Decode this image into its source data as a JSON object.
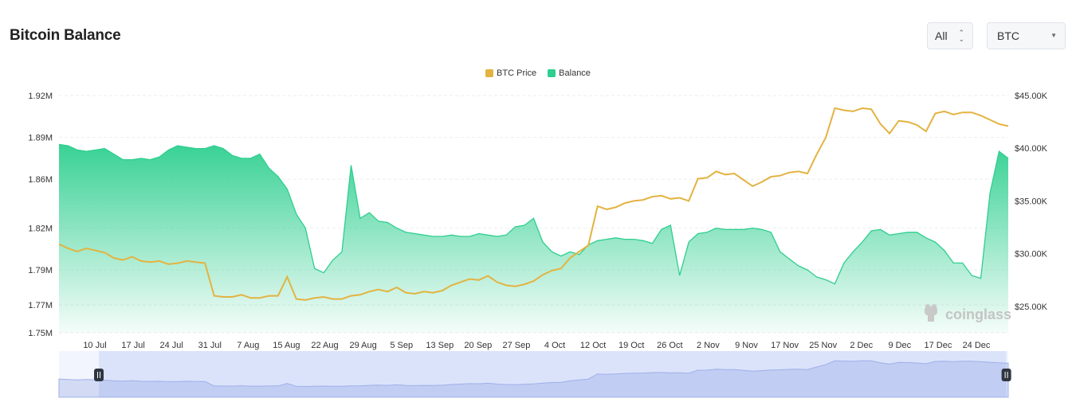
{
  "header": {
    "title": "Bitcoin Balance",
    "range_select": {
      "value": "All"
    },
    "asset_select": {
      "value": "BTC"
    }
  },
  "watermark": {
    "text": "coinglass"
  },
  "colors": {
    "price": "#e3b341",
    "balance": "#2ecf8f"
  },
  "chart_data": {
    "type": "line",
    "title": "",
    "legend": {
      "placement": "top-center",
      "entries": [
        "BTC Price",
        "Balance"
      ]
    },
    "grid": true,
    "x_tick_labels": [
      "10 Jul",
      "17 Jul",
      "24 Jul",
      "31 Jul",
      "7 Aug",
      "15 Aug",
      "22 Aug",
      "29 Aug",
      "5 Sep",
      "13 Sep",
      "20 Sep",
      "27 Sep",
      "4 Oct",
      "12 Oct",
      "19 Oct",
      "26 Oct",
      "2 Nov",
      "9 Nov",
      "17 Nov",
      "25 Nov",
      "2 Dec",
      "9 Dec",
      "17 Dec",
      "24 Dec"
    ],
    "y_left": {
      "ticks": [
        "1.92M",
        "1.89M",
        "1.86M",
        "1.82M",
        "1.79M",
        "1.77M",
        "1.75M"
      ],
      "range": [
        1.75,
        1.92
      ],
      "unit": "M"
    },
    "y_right": {
      "ticks": [
        "$45.00K",
        "$40.00K",
        "$35.00K",
        "$30.00K",
        "$25.00K"
      ],
      "range": [
        22.5,
        45
      ],
      "unit": "K USD"
    },
    "series": [
      {
        "name": "BTC Price",
        "axis": "right",
        "type": "line",
        "values": [
          30.9,
          30.5,
          30.2,
          30.5,
          30.3,
          30.1,
          29.6,
          29.4,
          29.7,
          29.3,
          29.2,
          29.3,
          29.0,
          29.1,
          29.3,
          29.2,
          29.1,
          26.0,
          25.9,
          25.9,
          26.1,
          25.8,
          25.8,
          26.0,
          26.0,
          27.8,
          25.7,
          25.6,
          25.8,
          25.9,
          25.7,
          25.7,
          26.0,
          26.1,
          26.4,
          26.6,
          26.4,
          26.8,
          26.3,
          26.2,
          26.4,
          26.3,
          26.5,
          27.0,
          27.3,
          27.6,
          27.5,
          27.9,
          27.3,
          27.0,
          26.9,
          27.1,
          27.4,
          28.0,
          28.4,
          28.6,
          29.6,
          30.2,
          30.8,
          34.5,
          34.2,
          34.4,
          34.8,
          35.0,
          35.1,
          35.4,
          35.5,
          35.2,
          35.3,
          35.0,
          37.1,
          37.2,
          37.8,
          37.5,
          37.6,
          37.0,
          36.4,
          36.8,
          37.3,
          37.4,
          37.7,
          37.8,
          37.6,
          39.4,
          41.0,
          43.8,
          43.6,
          43.5,
          43.8,
          43.7,
          42.3,
          41.4,
          42.6,
          42.5,
          42.2,
          41.6,
          43.3,
          43.5,
          43.2,
          43.4,
          43.4,
          43.1,
          42.7,
          42.3,
          42.1
        ]
      },
      {
        "name": "Balance",
        "axis": "left",
        "type": "area",
        "values": [
          1.885,
          1.884,
          1.881,
          1.88,
          1.881,
          1.882,
          1.878,
          1.874,
          1.874,
          1.875,
          1.874,
          1.876,
          1.881,
          1.884,
          1.883,
          1.882,
          1.882,
          1.884,
          1.882,
          1.877,
          1.875,
          1.875,
          1.878,
          1.868,
          1.862,
          1.853,
          1.835,
          1.825,
          1.796,
          1.793,
          1.802,
          1.808,
          1.87,
          1.832,
          1.836,
          1.83,
          1.829,
          1.825,
          1.822,
          1.821,
          1.82,
          1.819,
          1.819,
          1.82,
          1.819,
          1.819,
          1.821,
          1.82,
          1.819,
          1.82,
          1.826,
          1.827,
          1.832,
          1.815,
          1.808,
          1.805,
          1.808,
          1.806,
          1.813,
          1.816,
          1.817,
          1.818,
          1.817,
          1.817,
          1.816,
          1.814,
          1.824,
          1.827,
          1.791,
          1.815,
          1.821,
          1.822,
          1.825,
          1.824,
          1.824,
          1.824,
          1.825,
          1.824,
          1.822,
          1.808,
          1.803,
          1.798,
          1.795,
          1.79,
          1.788,
          1.785,
          1.8,
          1.808,
          1.815,
          1.823,
          1.824,
          1.82,
          1.821,
          1.822,
          1.822,
          1.818,
          1.815,
          1.809,
          1.8,
          1.8,
          1.791,
          1.789,
          1.85,
          1.88,
          1.875
        ]
      }
    ],
    "navigator": {
      "window": [
        0.042,
        0.998
      ]
    }
  }
}
